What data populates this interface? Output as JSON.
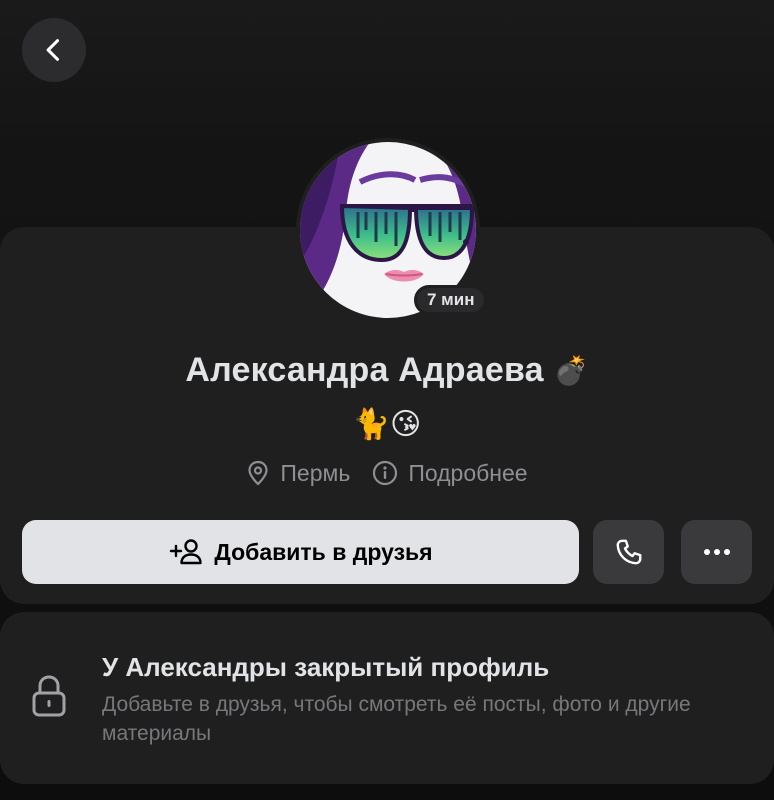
{
  "header": {
    "back_icon": "chevron-left-icon"
  },
  "profile": {
    "name": "Александра Адраева",
    "name_emoji": "💣",
    "status_emojis": "🐈😘",
    "online_badge": "7 мин",
    "city": "Пермь",
    "details_label": "Подробнее"
  },
  "actions": {
    "add_friend_label": "Добавить в друзья",
    "add_friend_icon": "add-person-icon",
    "call_icon": "phone-icon",
    "more_icon": "more-dots-icon"
  },
  "private": {
    "title": "У Александры закрытый профиль",
    "description": "Добавьте в друзья, чтобы смотреть её посты, фото и другие материалы",
    "icon": "lock-icon"
  },
  "colors": {
    "background": "#0d0d0d",
    "card": "#1f1f1f",
    "primary_button": "#e1e3e6",
    "secondary_button": "#3a3a3c",
    "muted_text": "#8e8e93"
  }
}
